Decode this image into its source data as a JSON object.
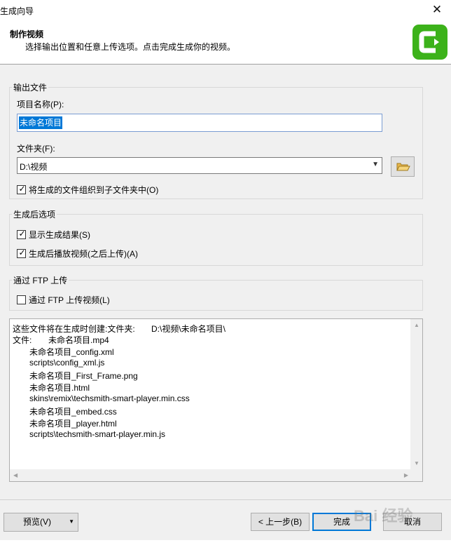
{
  "window": {
    "title": "生成向导",
    "close_label": "✕"
  },
  "header": {
    "title": "制作视频",
    "subtitle": "选择输出位置和任意上传选项。点击完成生成你的视频。",
    "logo": "camtasia-logo-icon",
    "logo_color": "#3cb21a"
  },
  "output": {
    "legend": "输出文件",
    "project_label": "项目名称(P):",
    "project_value": "未命名项目",
    "folder_label": "文件夹(F):",
    "folder_value": "D:\\视频",
    "organize_label": "将生成的文件组织到子文件夹中(O)",
    "organize_checked": true
  },
  "after": {
    "legend": "生成后选项",
    "show_results_label": "显示生成结果(S)",
    "show_results_checked": true,
    "play_label": "生成后播放视频(之后上传)(A)",
    "play_checked": true
  },
  "ftp": {
    "legend": "通过 FTP 上传",
    "upload_label": "通过 FTP 上传视频(L)",
    "upload_checked": false
  },
  "files": {
    "header_prefix": "这些文件将在生成时创建:文件夹:",
    "header_folder": "D:\\视频\\未命名项目\\",
    "file_prefix": "文件:",
    "main_file": "未命名项目.mp4",
    "items": [
      "未命名项目_config.xml",
      "scripts\\config_xml.js",
      "未命名项目_First_Frame.png",
      "未命名项目.html",
      "skins\\remix\\techsmith-smart-player.min.css",
      "未命名项目_embed.css",
      "未命名项目_player.html",
      "scripts\\techsmith-smart-player.min.js"
    ]
  },
  "buttons": {
    "preview": "预览(V)",
    "back": "< 上一步(B)",
    "finish": "完成",
    "cancel": "取消"
  },
  "watermark": "Bai 经验"
}
